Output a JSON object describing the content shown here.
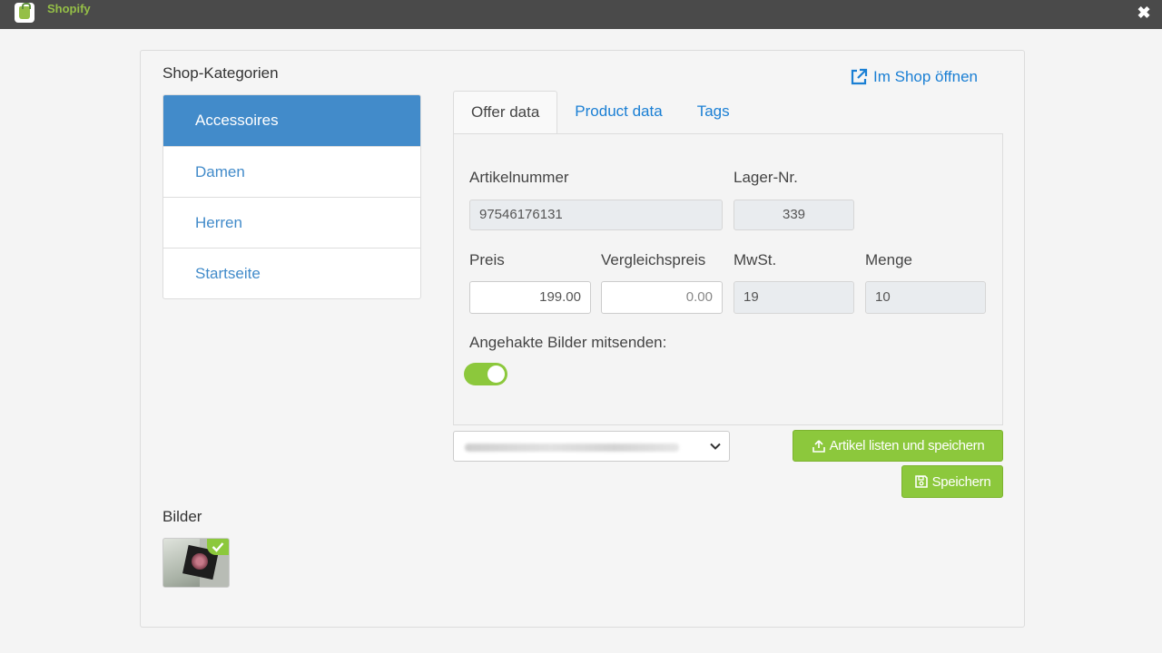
{
  "window": {
    "title": "Shopify",
    "close_icon": "close-icon",
    "logo_icon": "shopify-bag-icon"
  },
  "categories": {
    "heading": "Shop-Kategorien",
    "items": [
      {
        "label": "Accessoires",
        "active": true
      },
      {
        "label": "Damen",
        "active": false
      },
      {
        "label": "Herren",
        "active": false
      },
      {
        "label": "Startseite",
        "active": false
      }
    ]
  },
  "open_shop": {
    "label": "Im Shop öffnen",
    "icon": "external-link-icon"
  },
  "tabs": [
    {
      "label": "Offer data",
      "active": true
    },
    {
      "label": "Product data",
      "active": false
    },
    {
      "label": "Tags",
      "active": false
    }
  ],
  "offer": {
    "artikelnummer_label": "Artikelnummer",
    "artikelnummer_value": "97546176131",
    "lager_label": "Lager-Nr.",
    "lager_value": "339",
    "preis_label": "Preis",
    "preis_value": "199.00",
    "vergleichspreis_label": "Vergleichspreis",
    "vergleichspreis_placeholder": "0.00",
    "mwst_label": "MwSt.",
    "mwst_value": "19",
    "menge_label": "Menge",
    "menge_value": "10",
    "images_toggle_label": "Angehakte Bilder mitsenden:",
    "images_toggle_on": true
  },
  "shop_select": {
    "value_blurred": true
  },
  "buttons": {
    "list_and_save": "Artikel listen und speichern",
    "list_icon": "upload-icon",
    "save": "Speichern",
    "save_icon": "floppy-disk-icon"
  },
  "images": {
    "heading": "Bilder",
    "items": [
      {
        "subject": "watch in box",
        "checked": true
      }
    ]
  },
  "colors": {
    "accent_blue": "#428bca",
    "link_blue": "#1a7fd4",
    "green": "#8cc83c",
    "titlebar": "#4a4a4a",
    "shopify_green": "#95bf47"
  }
}
